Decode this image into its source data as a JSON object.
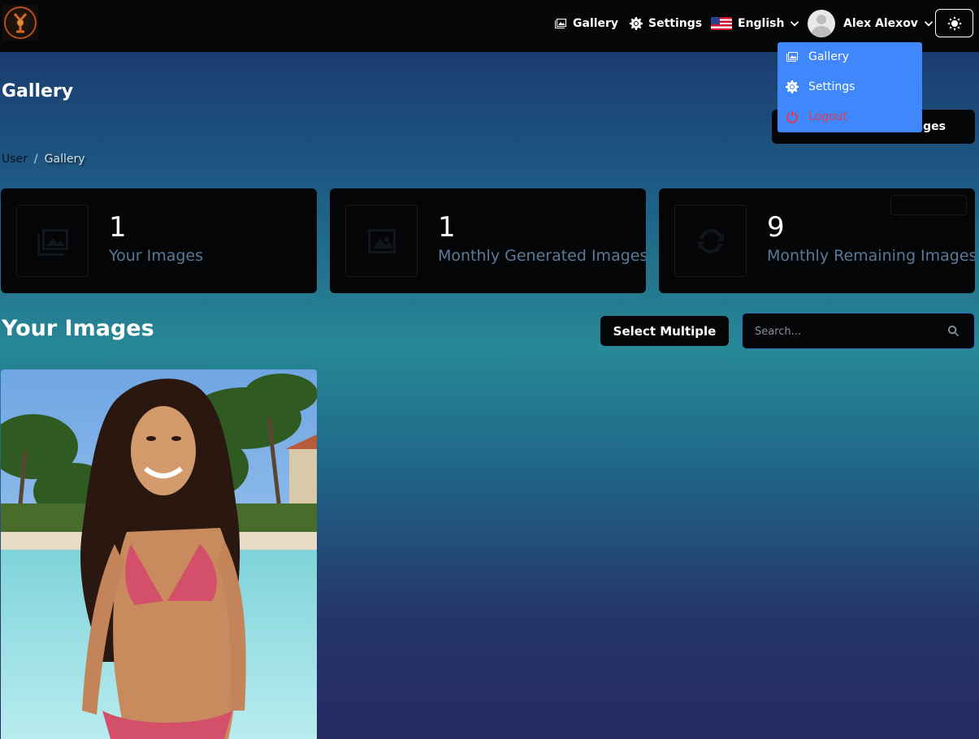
{
  "navbar": {
    "gallery_label": "Gallery",
    "settings_label": "Settings",
    "language_label": "English",
    "user_name": "Alex Alexov"
  },
  "page": {
    "title": "Gallery",
    "upgrade_label_visible": "ages",
    "breadcrumb": [
      "User",
      "/",
      "Gallery"
    ]
  },
  "dropdown": {
    "items": [
      {
        "label": "Gallery",
        "icon": "gallery-icon"
      },
      {
        "label": "Settings",
        "icon": "gear-icon"
      },
      {
        "label": "Logout",
        "icon": "power-icon"
      }
    ]
  },
  "stats": [
    {
      "value": "1",
      "label": "Your Images",
      "icon": "images-icon"
    },
    {
      "value": "1",
      "label": "Monthly Generated Images",
      "icon": "image-icon"
    },
    {
      "value": "9",
      "label": "Monthly Remaining Images",
      "icon": "refresh-icon"
    }
  ],
  "section": {
    "title": "Your Images",
    "select_multiple_label": "Select Multiple",
    "search_placeholder": "Search..."
  },
  "colors": {
    "accent": "#3f87fb",
    "logout": "#e53950",
    "navbar_bg": "#050608"
  }
}
